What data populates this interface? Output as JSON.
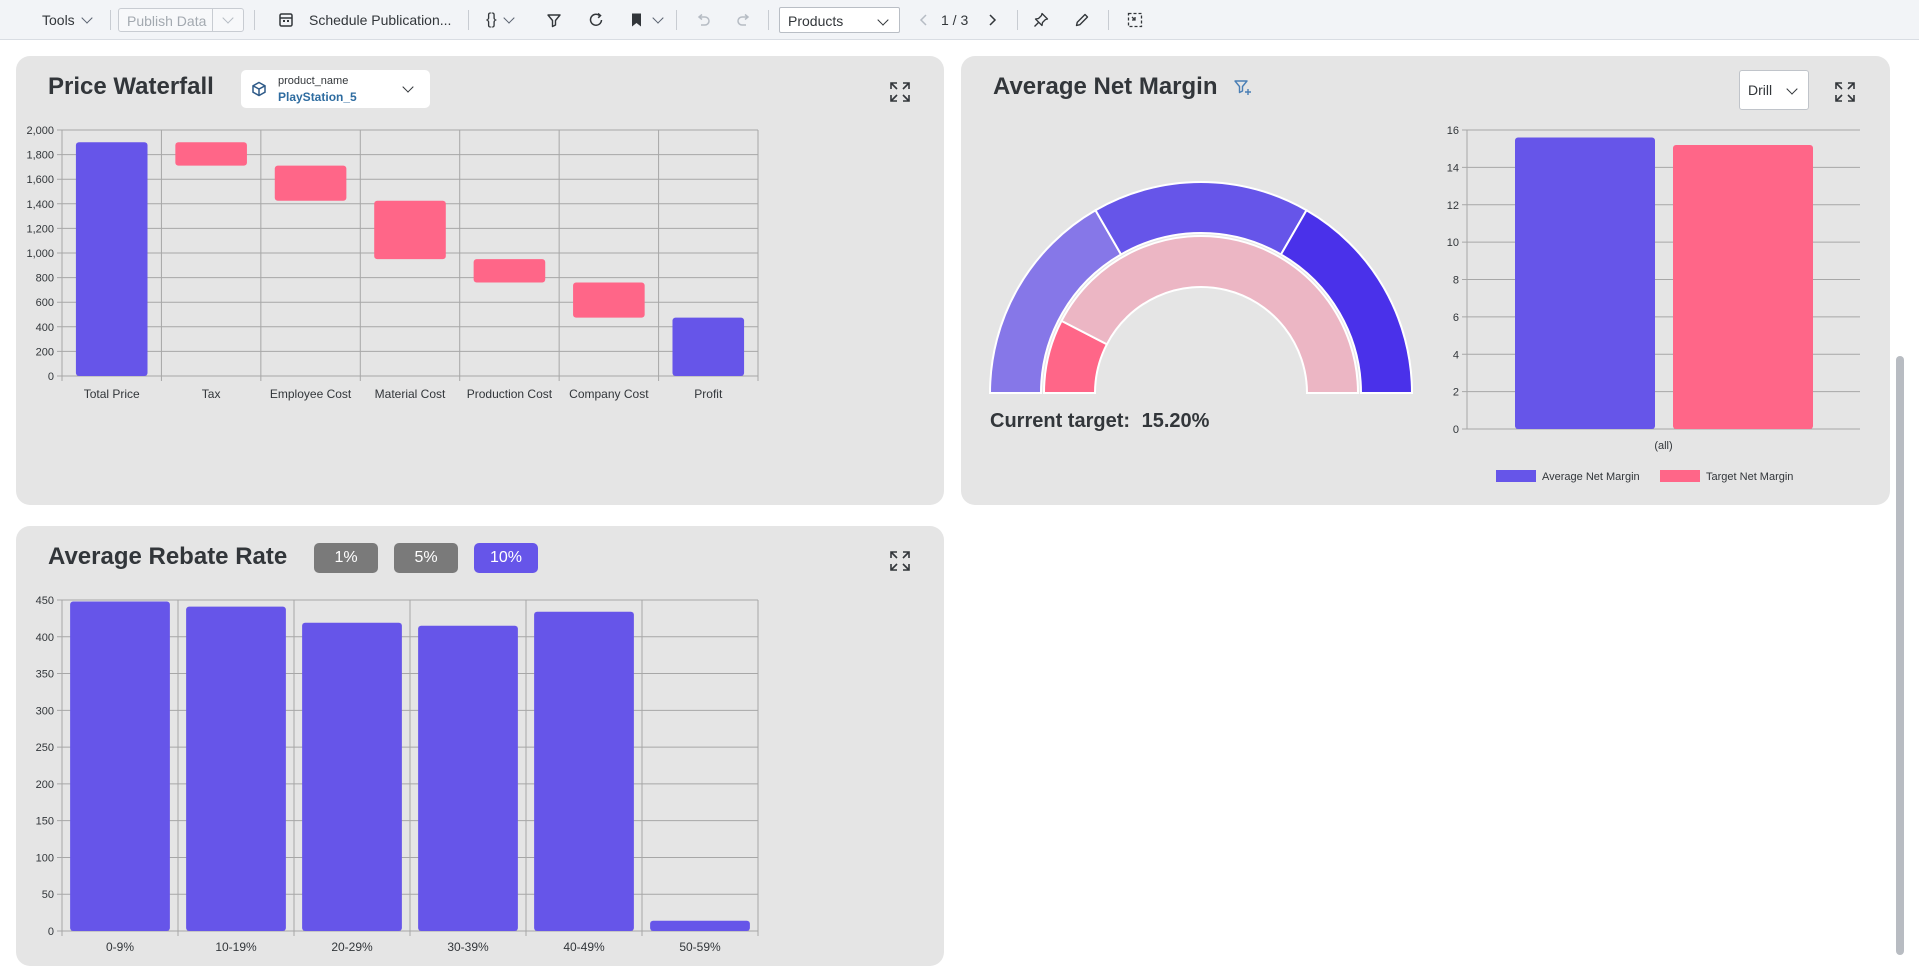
{
  "toolbar": {
    "tools_label": "Tools",
    "publish_label": "Publish Data",
    "schedule_label": "Schedule Publication...",
    "page_select": "Products",
    "page_indicator": "1 / 3"
  },
  "colors": {
    "primary": "#6655e9",
    "accent": "#ff6688",
    "gauge_light": "#8677e8",
    "gauge_dark": "#4a31ea",
    "gauge_pink_light": "#ecb6c4"
  },
  "price_waterfall": {
    "title": "Price Waterfall",
    "filter_key": "product_name",
    "filter_value": "PlayStation_5"
  },
  "net_margin": {
    "title": "Average Net Margin",
    "drill_label": "Drill",
    "target_label": "Current target:",
    "target_value": "15.20%"
  },
  "rebate": {
    "title": "Average Rebate Rate",
    "buttons": [
      "1%",
      "5%",
      "10%"
    ],
    "selected": "10%"
  },
  "chart_data": [
    {
      "type": "bar",
      "subtype": "waterfall",
      "categories": [
        "Total Price",
        "Tax",
        "Employee Cost",
        "Material Cost",
        "Production Cost",
        "Company Cost",
        "Profit"
      ],
      "ranges": [
        [
          0,
          1900
        ],
        [
          1710,
          1900
        ],
        [
          1425,
          1710
        ],
        [
          950,
          1425
        ],
        [
          760,
          950
        ],
        [
          475,
          760
        ],
        [
          0,
          475
        ]
      ],
      "kinds": [
        "total",
        "decrease",
        "decrease",
        "decrease",
        "decrease",
        "decrease",
        "total"
      ],
      "ylim": [
        0,
        2000
      ],
      "yticks": [
        "0",
        "200",
        "400",
        "600",
        "800",
        "1,000",
        "1,200",
        "1,400",
        "1,600",
        "1,800",
        "2,000"
      ],
      "grid": true
    },
    {
      "type": "pie",
      "subtype": "semi-donut",
      "outer_ring": [
        1,
        1,
        1
      ],
      "inner_ring": {
        "value": 15.2,
        "max": 100
      }
    },
    {
      "type": "bar",
      "categories": [
        "(all)"
      ],
      "series": [
        {
          "name": "Average Net Margin",
          "values": [
            15.6
          ]
        },
        {
          "name": "Target Net Margin",
          "values": [
            15.2
          ]
        }
      ],
      "ylim": [
        0,
        16
      ],
      "yticks": [
        "0",
        "2",
        "4",
        "6",
        "8",
        "10",
        "12",
        "14",
        "16"
      ],
      "legend": "bottom",
      "grid": true
    },
    {
      "type": "bar",
      "categories": [
        "0-9%",
        "10-19%",
        "20-29%",
        "30-39%",
        "40-49%",
        "50-59%"
      ],
      "values": [
        448,
        441,
        419,
        415,
        434,
        14
      ],
      "ylim": [
        0,
        450
      ],
      "yticks": [
        "0",
        "50",
        "100",
        "150",
        "200",
        "250",
        "300",
        "350",
        "400",
        "450"
      ],
      "grid": true
    }
  ]
}
